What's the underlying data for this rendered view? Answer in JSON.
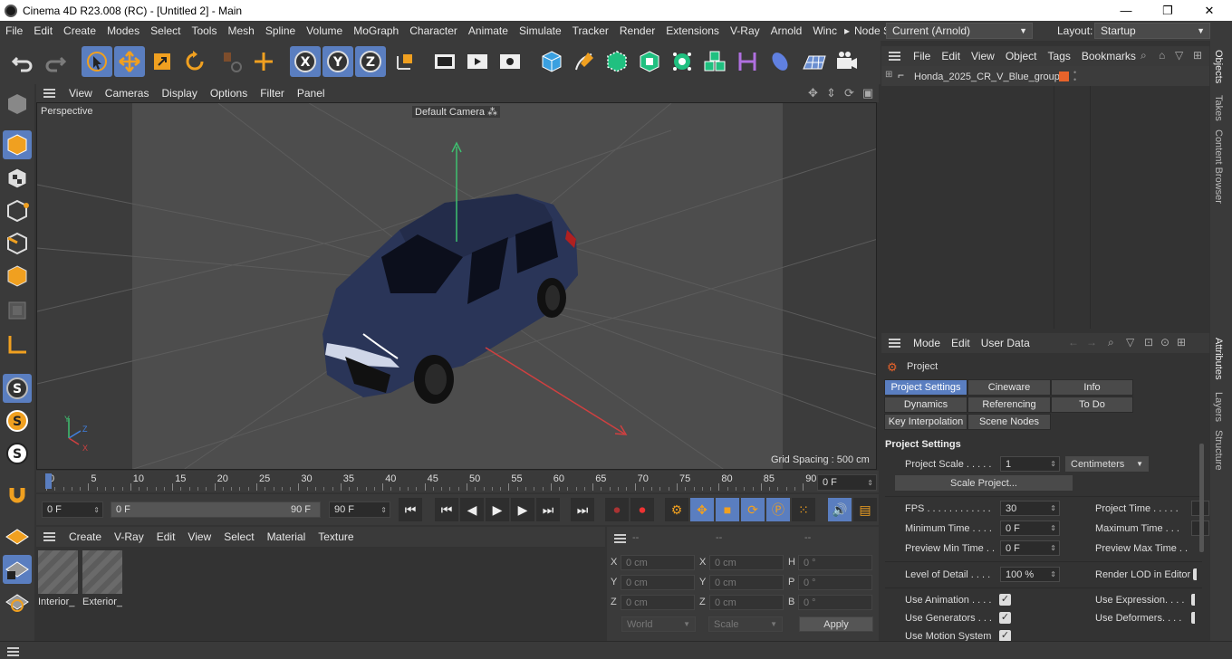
{
  "window": {
    "title": "Cinema 4D R23.008 (RC) - [Untitled 2] - Main",
    "min": "—",
    "max": "❐",
    "close": "✕"
  },
  "menu": [
    "File",
    "Edit",
    "Create",
    "Modes",
    "Select",
    "Tools",
    "Mesh",
    "Spline",
    "Volume",
    "MoGraph",
    "Character",
    "Animate",
    "Simulate",
    "Tracker",
    "Render",
    "Extensions",
    "V-Ray",
    "Arnold",
    "Winc"
  ],
  "menu_overflow": "▸",
  "node_space": {
    "label": "Node Space:",
    "value": "Current (Arnold)"
  },
  "layout": {
    "label": "Layout:",
    "value": "Startup"
  },
  "viewport": {
    "menu": [
      "View",
      "Cameras",
      "Display",
      "Options",
      "Filter",
      "Panel"
    ],
    "perspective": "Perspective",
    "camera": "Default Camera",
    "camera_glyph": "⁂",
    "grid_spacing": "Grid Spacing : 500 cm",
    "axis_y": "Y",
    "axis_z": "Z",
    "axis_x": "X"
  },
  "timeline": {
    "ticks": [
      "0",
      "5",
      "10",
      "15",
      "20",
      "25",
      "30",
      "35",
      "40",
      "45",
      "50",
      "55",
      "60",
      "65",
      "70",
      "75",
      "80",
      "85",
      "90"
    ],
    "current_frame": "0 F",
    "start": "0 F",
    "range_start": "0 F",
    "range_end": "90 F",
    "end": "90 F"
  },
  "material_manager": {
    "menu": [
      "Create",
      "V-Ray",
      "Edit",
      "View",
      "Select",
      "Material",
      "Texture"
    ],
    "materials": [
      "Interior_",
      "Exterior_"
    ]
  },
  "coordinates": {
    "headers": [
      "--",
      "--",
      "--"
    ],
    "rows": [
      {
        "a": "X",
        "av": "0 cm",
        "b": "X",
        "bv": "0 cm",
        "c": "H",
        "cv": "0 °"
      },
      {
        "a": "Y",
        "av": "0 cm",
        "b": "Y",
        "bv": "0 cm",
        "c": "P",
        "cv": "0 °"
      },
      {
        "a": "Z",
        "av": "0 cm",
        "b": "Z",
        "bv": "0 cm",
        "c": "B",
        "cv": "0 °"
      }
    ],
    "world": "World",
    "scale": "Scale",
    "apply": "Apply"
  },
  "objects": {
    "menu": [
      "File",
      "Edit",
      "View",
      "Object",
      "Tags",
      "Bookmarks"
    ],
    "items": [
      {
        "name": "Honda_2025_CR_V_Blue_group",
        "color": "#e8632a"
      }
    ]
  },
  "attributes": {
    "menu": [
      "Mode",
      "Edit",
      "User Data"
    ],
    "title": "Project",
    "tabs_row1": [
      "Project Settings",
      "Cineware",
      "Info"
    ],
    "tabs_row2": [
      "Dynamics",
      "Referencing",
      "To Do"
    ],
    "tabs_row3": [
      "Key Interpolation",
      "Scene Nodes"
    ],
    "section": "Project Settings",
    "project_scale": {
      "label": "Project Scale . . . . .",
      "value": "1",
      "unit": "Centimeters"
    },
    "scale_button": "Scale Project...",
    "fps": {
      "label": "FPS . . . . . . . . . . . .",
      "value": "30"
    },
    "project_time": "Project Time . . . . .",
    "min_time": {
      "label": "Minimum Time . . . .",
      "value": "0 F"
    },
    "max_time": "Maximum Time . . .",
    "preview_min": {
      "label": "Preview Min Time . .",
      "value": "0 F"
    },
    "preview_max": "Preview Max Time . .",
    "lod": {
      "label": "Level of Detail . . . .",
      "value": "100 %"
    },
    "render_lod": "Render LOD in Editor",
    "use_animation": "Use Animation . . . .",
    "use_expression": "Use Expression. . . .",
    "use_generators": "Use Generators . . .",
    "use_deformers": "Use Deformers. . . .",
    "use_motion": "Use Motion System",
    "check": "✓"
  },
  "side_tabs": [
    "Objects",
    "Takes",
    "Content Browser",
    "Attributes",
    "Layers",
    "Structure"
  ],
  "colors": {
    "accent": "#5a7ec0",
    "panel": "#3a3a3a",
    "car": "#2a3558"
  }
}
